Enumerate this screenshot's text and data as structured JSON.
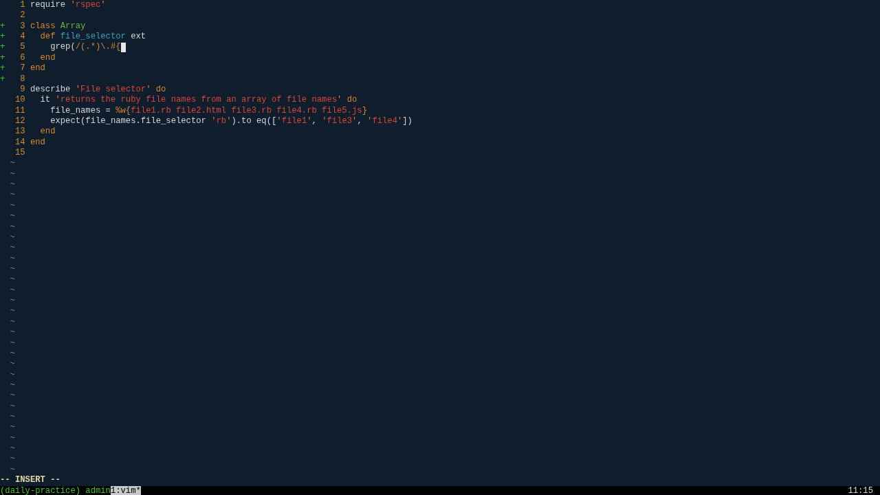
{
  "editor": {
    "lines": [
      {
        "number": "1",
        "tokens": [
          {
            "text": "require ",
            "kind": "plain"
          },
          {
            "text": "'",
            "kind": "delim"
          },
          {
            "text": "rspec",
            "kind": "string"
          },
          {
            "text": "'",
            "kind": "delim"
          }
        ]
      },
      {
        "number": "2"
      },
      {
        "number": "3",
        "sign": "+",
        "tokens": [
          {
            "text": "class ",
            "kind": "keyword"
          },
          {
            "text": "Array",
            "kind": "constant"
          }
        ]
      },
      {
        "number": "4",
        "sign": "+",
        "tokens": [
          {
            "text": "  def ",
            "kind": "keyword"
          },
          {
            "text": "file_selector",
            "kind": "function"
          },
          {
            "text": " ext",
            "kind": "plain"
          }
        ]
      },
      {
        "number": "5",
        "sign": "+",
        "cursor": true,
        "tokens": [
          {
            "text": "    grep(",
            "kind": "plain"
          },
          {
            "text": "/(.*)\\.#{",
            "kind": "delim"
          }
        ]
      },
      {
        "number": "6",
        "sign": "+",
        "tokens": [
          {
            "text": "  end",
            "kind": "keyword"
          }
        ]
      },
      {
        "number": "7",
        "sign": "+",
        "tokens": [
          {
            "text": "end",
            "kind": "keyword"
          }
        ]
      },
      {
        "number": "8",
        "sign": "+"
      },
      {
        "number": "9",
        "tokens": [
          {
            "text": "describe ",
            "kind": "plain"
          },
          {
            "text": "'",
            "kind": "delim"
          },
          {
            "text": "File selector",
            "kind": "string"
          },
          {
            "text": "' do",
            "kind": "delim"
          }
        ]
      },
      {
        "number": "10",
        "tokens": [
          {
            "text": "  it ",
            "kind": "plain"
          },
          {
            "text": "'",
            "kind": "delim"
          },
          {
            "text": "returns the ruby file names from an array of file names",
            "kind": "string"
          },
          {
            "text": "' do",
            "kind": "delim"
          }
        ]
      },
      {
        "number": "11",
        "tokens": [
          {
            "text": "    file_names = ",
            "kind": "plain"
          },
          {
            "text": "%w{",
            "kind": "delim"
          },
          {
            "text": "file1.rb file2.html file3.rb file4.rb file5.js",
            "kind": "string"
          },
          {
            "text": "}",
            "kind": "delim"
          }
        ]
      },
      {
        "number": "12",
        "tokens": [
          {
            "text": "    expect(file_names.file_selector ",
            "kind": "plain"
          },
          {
            "text": "'",
            "kind": "delim"
          },
          {
            "text": "rb",
            "kind": "string"
          },
          {
            "text": "'",
            "kind": "delim"
          },
          {
            "text": ").to eq([",
            "kind": "plain"
          },
          {
            "text": "'",
            "kind": "delim"
          },
          {
            "text": "file1",
            "kind": "string"
          },
          {
            "text": "'",
            "kind": "delim"
          },
          {
            "text": ", ",
            "kind": "plain"
          },
          {
            "text": "'",
            "kind": "delim"
          },
          {
            "text": "file3",
            "kind": "string"
          },
          {
            "text": "'",
            "kind": "delim"
          },
          {
            "text": ", ",
            "kind": "plain"
          },
          {
            "text": "'",
            "kind": "delim"
          },
          {
            "text": "file4",
            "kind": "string"
          },
          {
            "text": "'",
            "kind": "delim"
          },
          {
            "text": "])",
            "kind": "plain"
          }
        ]
      },
      {
        "number": "13",
        "tokens": [
          {
            "text": "  end",
            "kind": "keyword"
          }
        ]
      },
      {
        "number": "14",
        "tokens": [
          {
            "text": "end",
            "kind": "keyword"
          }
        ]
      },
      {
        "number": "15"
      }
    ],
    "filler_lines": [
      "~",
      "~",
      "~",
      "~",
      "~",
      "~",
      "~",
      "~",
      "~",
      "~",
      "~",
      "~",
      "~",
      "~",
      "~",
      "~",
      "~",
      "~",
      "~",
      "~",
      "~",
      "~",
      "~",
      "~",
      "~",
      "~",
      "~",
      "~",
      "~",
      "~"
    ]
  },
  "mode_line": "-- INSERT --",
  "tmux_bar": {
    "session": "(daily-practice)",
    "host": "admin",
    "windows": [
      {
        "label": "1:vim*",
        "selected": true
      }
    ],
    "clock": "11:15"
  }
}
